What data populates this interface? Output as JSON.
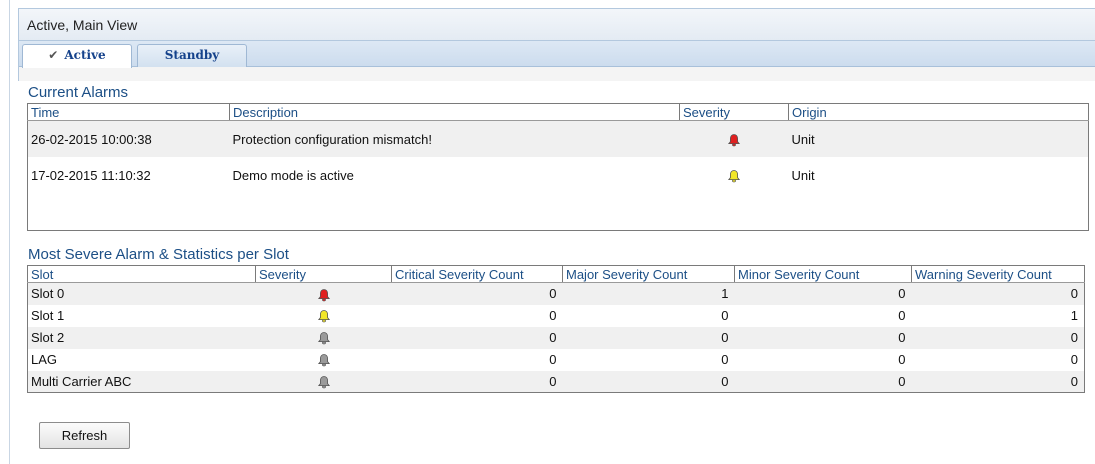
{
  "window": {
    "title": "Active, Main View"
  },
  "tabs": [
    {
      "label": "Active",
      "active": true,
      "icon": "checkmark-icon"
    },
    {
      "label": "Standby",
      "active": false
    }
  ],
  "current_alarms": {
    "title": "Current Alarms",
    "columns": [
      "Time",
      "Description",
      "Severity",
      "Origin"
    ],
    "rows": [
      {
        "time": "26-02-2015 10:00:38",
        "description": "Protection configuration mismatch!",
        "severity": "critical",
        "origin": "Unit"
      },
      {
        "time": "17-02-2015 11:10:32",
        "description": "Demo mode is active",
        "severity": "warning",
        "origin": "Unit"
      }
    ]
  },
  "slot_stats": {
    "title": "Most Severe Alarm & Statistics per Slot",
    "columns": [
      "Slot",
      "Severity",
      "Critical Severity Count",
      "Major Severity Count",
      "Minor Severity Count",
      "Warning Severity Count"
    ],
    "rows": [
      {
        "slot": "Slot 0",
        "severity": "critical",
        "critical": "0",
        "major": "1",
        "minor": "0",
        "warning": "0"
      },
      {
        "slot": "Slot 1",
        "severity": "warning",
        "critical": "0",
        "major": "0",
        "minor": "0",
        "warning": "1"
      },
      {
        "slot": "Slot 2",
        "severity": "cleared",
        "critical": "0",
        "major": "0",
        "minor": "0",
        "warning": "0"
      },
      {
        "slot": "LAG",
        "severity": "cleared",
        "critical": "0",
        "major": "0",
        "minor": "0",
        "warning": "0"
      },
      {
        "slot": "Multi Carrier ABC",
        "severity": "cleared",
        "critical": "0",
        "major": "0",
        "minor": "0",
        "warning": "0"
      }
    ]
  },
  "severity_colors": {
    "critical": "#e02020",
    "warning": "#f2e62a",
    "cleared": "#9a9a9a"
  },
  "buttons": {
    "refresh": "Refresh"
  }
}
